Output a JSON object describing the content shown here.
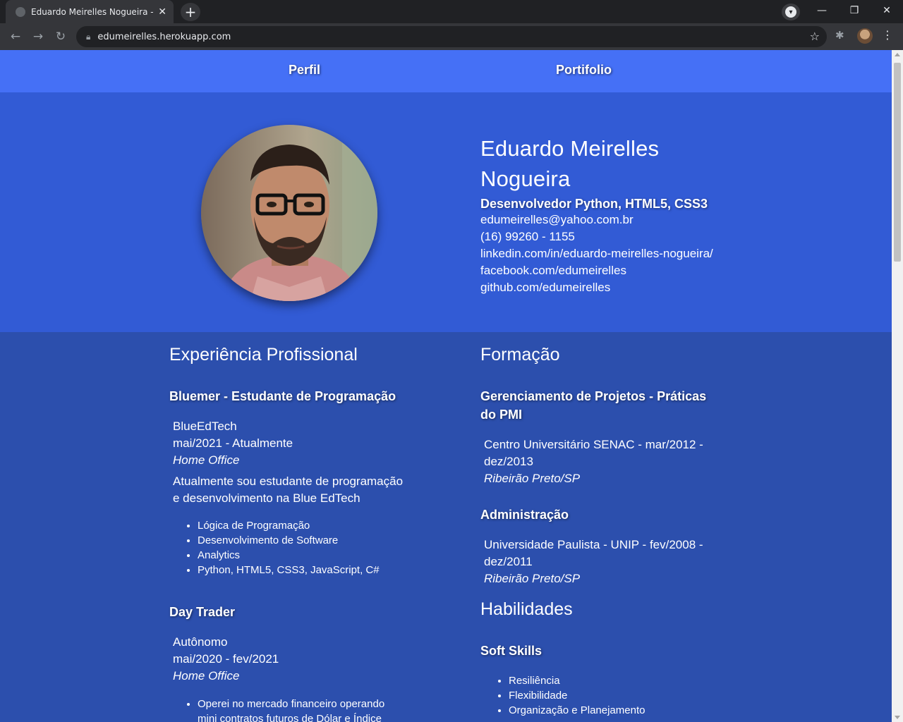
{
  "browser": {
    "tab_title": "Eduardo Meirelles Nogueira - Desenvolvedor",
    "url": "edumeirelles.herokuapp.com"
  },
  "nav": {
    "perfil": "Perfil",
    "portifolio": "Portifolio"
  },
  "profile": {
    "name_line1": "Eduardo Meirelles",
    "name_line2": "Nogueira",
    "role": "Desenvolvedor Python, HTML5, CSS3",
    "email": "edumeirelles@yahoo.com.br",
    "phone": "(16) 99260 - 1155",
    "linkedin": "linkedin.com/in/eduardo-meirelles-nogueira/",
    "facebook": "facebook.com/edumeirelles",
    "github": "github.com/edumeirelles"
  },
  "experience": {
    "title": "Experiência Profissional",
    "jobs": [
      {
        "title": "Bluemer - Estudante de Programação",
        "company": "BlueEdTech",
        "period": "mai/2021 - Atualmente",
        "location": "Home Office",
        "description_line1": "Atualmente sou estudante de programação",
        "description_line2": "e desenvolvimento na Blue EdTech",
        "items": [
          "Lógica de Programação",
          "Desenvolvimento de Software",
          "Analytics",
          "Python, HTML5, CSS3, JavaScript, C#"
        ]
      },
      {
        "title": "Day Trader",
        "company": "Autônomo",
        "period": "mai/2020 - fev/2021",
        "location": "Home Office",
        "items": [
          "Operei no mercado financeiro operando",
          "mini contratos futuros de Dólar e Índice"
        ]
      }
    ]
  },
  "education": {
    "title": "Formação",
    "courses": [
      {
        "title_line1": "Gerenciamento de Projetos - Práticas",
        "title_line2": "do PMI",
        "institution_line1": "Centro Universitário SENAC - mar/2012 -",
        "institution_line2": "dez/2013",
        "location": "Ribeirão Preto/SP"
      },
      {
        "title_line1": "Administração",
        "institution_line1": "Universidade Paulista - UNIP - fev/2008 -",
        "institution_line2": "dez/2011",
        "location": "Ribeirão Preto/SP"
      }
    ]
  },
  "skills": {
    "title": "Habilidades",
    "soft_title": "Soft Skills",
    "soft": [
      "Resiliência",
      "Flexibilidade",
      "Organização e Planejamento"
    ]
  }
}
